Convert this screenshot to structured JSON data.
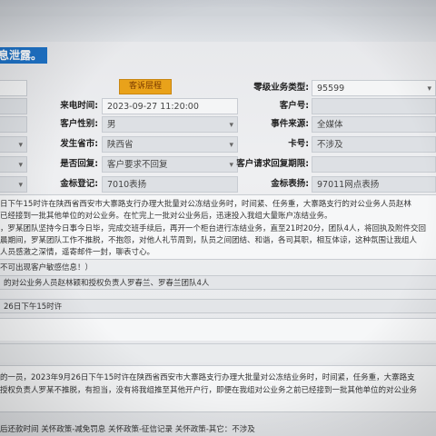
{
  "banner": "息泄露。",
  "buttons": {
    "complaint_flow": "客诉层程"
  },
  "fields": {
    "incoming_time_label": "来电时间:",
    "incoming_time_value": "2023-09-27 11:20:00",
    "customer_gender_label": "客户性别:",
    "customer_gender_value": "男",
    "location_label": "发生省市:",
    "location_value": "陕西省",
    "reply_label": "是否回复:",
    "reply_value": "客户要求不回复",
    "flag_label": "金标登记:",
    "flag_value": "7010表扬",
    "zero_level_label": "零级业务类型:",
    "zero_level_value": "95599",
    "customer_no_label": "客户号:",
    "event_source_label": "事件来源:",
    "event_source_value": "全媒体",
    "card_label": "卡号:",
    "card_value": "不涉及",
    "reply_deadline_label": "客户请求回复期限:",
    "flag_reply_label": "金标表扬:",
    "flag_reply_value": "97011网点表扬"
  },
  "description": [
    "日下午15时许在陕西省西安市大寨路支行办理大批量对公冻结业务时，时间紧、任务重，大寨路支行的对公业务人员赵林",
    "已经接到一批其他单位的对公业务。在忙完上一批对公业务后，迅速投入我组大量账户冻结业务。",
    "，罗某团队坚持今日事今日毕，完成交班手续后，再开一个柜台进行冻结业务，直至21时20分，团队4人，将回执及附件交回",
    "晨期间，罗某团队工作不推脱，不抱怨，对他人礼节周到，队员之间团结、和谐，各司其职，相互体谅，这种氛围让我组人",
    "人员感激之深情，遥寄邮件一封，聊表寸心。"
  ],
  "note": "不可出现客户敏感信息！）",
  "bars": {
    "object": "的对公业务人员赵林颖和授权负责人罗春兰、罗春兰团队4人",
    "time": "26日下午15时许"
  },
  "para2": [
    "的一员，2023年9月26日下午15时许在陕西省西安市大寨路支行办理大批量对公冻结业务时，时间紧，任务重，大寨路支",
    "授权负责人罗某不推脱，有担当，没有将我组推至其他开户行，即便在我组对公业务之前已经接到一批其他单位的对公业务"
  ],
  "bottom": "后还款时间  关怀政策-减免罚息  关怀政策-征信记录  关怀政策-其它：不涉及"
}
